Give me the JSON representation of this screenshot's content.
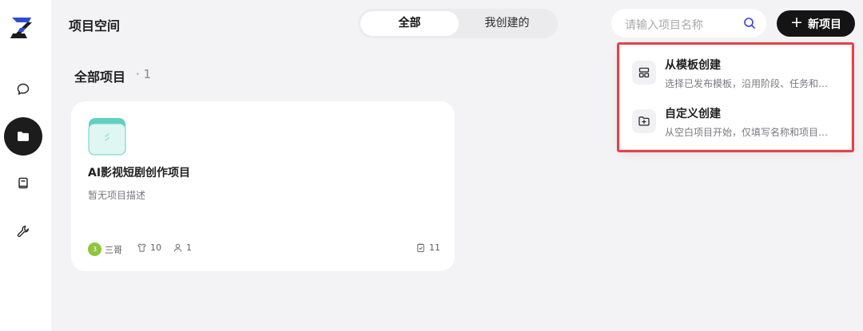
{
  "header": {
    "title": "项目空间",
    "tabs": [
      {
        "label": "全部",
        "active": true
      },
      {
        "label": "我创建的",
        "active": false
      }
    ],
    "search": {
      "placeholder": "请输入项目名称"
    },
    "new_button": {
      "label": "新项目"
    }
  },
  "sidebar": {
    "items": [
      {
        "icon": "chat-icon",
        "active": false
      },
      {
        "icon": "folder-icon",
        "active": true
      },
      {
        "icon": "book-icon",
        "active": false
      },
      {
        "icon": "wrench-icon",
        "active": false
      }
    ]
  },
  "section": {
    "title": "全部项目",
    "count": "· 1"
  },
  "projects": [
    {
      "title": "AI影视短剧创作项目",
      "description": "暂无项目描述",
      "owner": "三哥",
      "avatar_text": "3",
      "roles_count": "10",
      "members_count": "1",
      "tasks_count": "11"
    }
  ],
  "dropdown": {
    "items": [
      {
        "title": "从模板创建",
        "desc": "选择已发布模板，沿用阶段、任务和…",
        "icon": "template-icon"
      },
      {
        "title": "自定义创建",
        "desc": "从空白项目开始，仅填写名称和项目…",
        "icon": "folder-plus-icon"
      }
    ]
  },
  "colors": {
    "accent": "#141414",
    "highlight": "#e4424a",
    "avatar": "#8cc63e",
    "thumb": "#5fd1c0"
  }
}
